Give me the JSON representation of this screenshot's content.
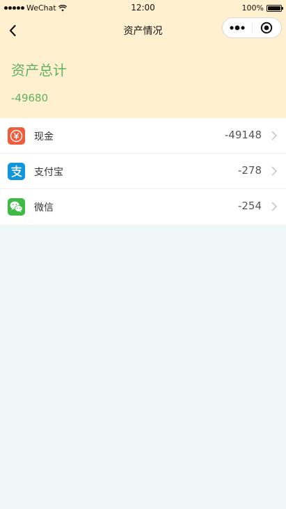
{
  "status_bar": {
    "carrier": "WeChat",
    "time": "12:00",
    "battery": "100%"
  },
  "nav": {
    "title": "资产情况"
  },
  "summary": {
    "title": "资产总计",
    "total": "-49680"
  },
  "colors": {
    "header_bg": "#fff1cf",
    "accent_green": "#5fb15f",
    "page_bg": "#f0f7f8",
    "cash_icon": "#f05b39",
    "alipay_icon": "#1296db",
    "wechat_icon": "#3fba45"
  },
  "assets": [
    {
      "name": "现金",
      "amount": "-49148",
      "icon": "yen-icon"
    },
    {
      "name": "支付宝",
      "amount": "-278",
      "icon": "alipay-icon"
    },
    {
      "name": "微信",
      "amount": "-254",
      "icon": "wechat-icon"
    }
  ]
}
